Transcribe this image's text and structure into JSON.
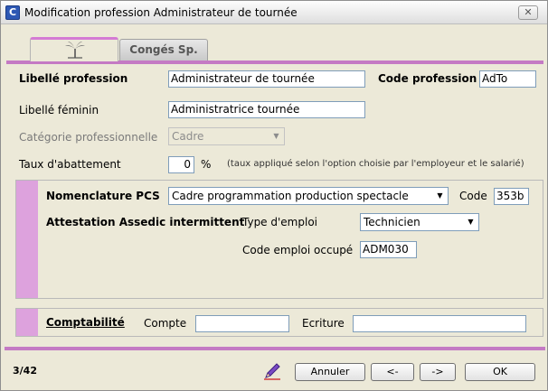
{
  "window": {
    "title": "Modification profession Administrateur de tournée",
    "app_icon": "C",
    "close_glyph": "✕"
  },
  "tabs": {
    "active_icon": "palm-tree-icon",
    "conges_label": "Congés Sp."
  },
  "form": {
    "libelle_profession_label": "Libellé profession",
    "libelle_profession_value": "Administrateur de tournée",
    "code_profession_label": "Code profession",
    "code_profession_value": "AdTo",
    "libelle_feminin_label": "Libellé féminin",
    "libelle_feminin_value": "Administratrice  tournée",
    "categorie_label": "Catégorie professionnelle",
    "categorie_value": "Cadre",
    "taux_label": "Taux d'abattement",
    "taux_value": "0",
    "taux_unit": "%",
    "taux_note": "(taux appliqué selon l'option choisie par l'employeur et le salarié)"
  },
  "assedic_panel": {
    "pcs_label": "Nomenclature PCS",
    "pcs_value": "Cadre programmation production spectacle",
    "code_label": "Code",
    "code_value": "353b",
    "attestation_label": "Attestation Assedic intermittent",
    "type_emploi_label": "Type d'emploi",
    "type_emploi_value": "Technicien",
    "code_emploi_label": "Code emploi occupé",
    "code_emploi_value": "ADM030"
  },
  "compta_panel": {
    "title": "Comptabilité",
    "compte_label": "Compte",
    "compte_value": "",
    "ecriture_label": "Ecriture",
    "ecriture_value": ""
  },
  "footer": {
    "record_position": "3/42",
    "annuler_label": "Annuler",
    "prev_label": "<-",
    "next_label": "->",
    "ok_label": "OK"
  },
  "colors": {
    "accent": "#c47ac4",
    "accent_light": "#dda2dd",
    "window_bg": "#ece9d8"
  }
}
